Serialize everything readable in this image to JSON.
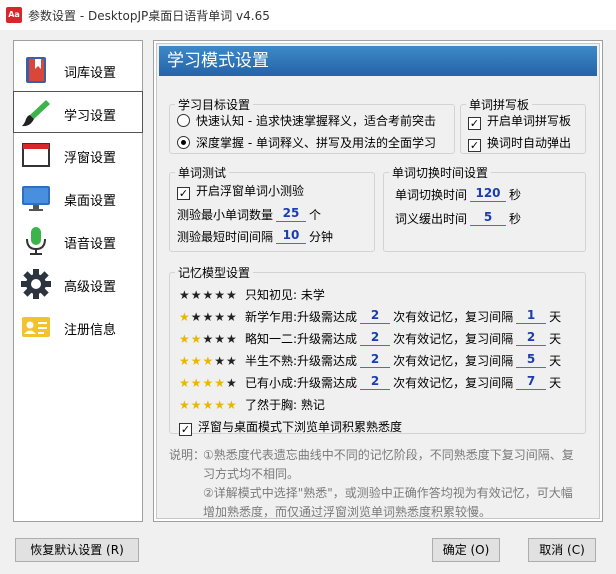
{
  "window": {
    "app_icon": "Aa",
    "title": "参数设置 - DesktopJP桌面日语背单词 v4.65"
  },
  "nav": [
    {
      "label": "词库设置",
      "icon": "book-icon"
    },
    {
      "label": "学习设置",
      "icon": "brush-icon"
    },
    {
      "label": "浮窗设置",
      "icon": "window-icon"
    },
    {
      "label": "桌面设置",
      "icon": "monitor-icon"
    },
    {
      "label": "语音设置",
      "icon": "microphone-icon"
    },
    {
      "label": "高级设置",
      "icon": "gear-icon"
    },
    {
      "label": "注册信息",
      "icon": "id-card-icon"
    }
  ],
  "active_nav": "学习设置",
  "page_title": "学习模式设置",
  "goal": {
    "legend": "学习目标设置",
    "option1": "快速认知 - 追求快速掌握释义，适合考前突击",
    "option2": "深度掌握 - 单词释义、拼写及用法的全面学习",
    "selected": "深度掌握"
  },
  "spelling": {
    "legend": "单词拼写板",
    "open_label": "开启单词拼写板",
    "auto_popup_label": "换词时自动弹出",
    "open_checked": true,
    "auto_popup_checked": true
  },
  "quiz": {
    "legend": "单词测试",
    "enable_label": "开启浮窗单词小测验",
    "enable_checked": true,
    "min_words_prefix": "测验最小单词数量",
    "min_words_value": "25",
    "min_words_unit": "个",
    "min_interval_prefix": "测验最短时间间隔",
    "min_interval_value": "10",
    "min_interval_unit": "分钟"
  },
  "switch": {
    "legend": "单词切换时间设置",
    "switch_prefix": "单词切换时间",
    "switch_value": "120",
    "switch_unit": "秒",
    "delay_prefix": "词义缓出时间",
    "delay_value": "5",
    "delay_unit": "秒"
  },
  "memory": {
    "legend": "记忆模型设置",
    "levels": [
      {
        "stars_filled": 0,
        "name": "只知初见:",
        "text": "未学"
      },
      {
        "stars_filled": 1,
        "name": "新学乍用:",
        "upgrade": "升级需达成",
        "count": "2",
        "mid": "次有效记忆，复习间隔",
        "days": "1",
        "unit": "天"
      },
      {
        "stars_filled": 2,
        "name": "略知一二:",
        "upgrade": "升级需达成",
        "count": "2",
        "mid": "次有效记忆，复习间隔",
        "days": "2",
        "unit": "天"
      },
      {
        "stars_filled": 3,
        "name": "半生不熟:",
        "upgrade": "升级需达成",
        "count": "2",
        "mid": "次有效记忆，复习间隔",
        "days": "5",
        "unit": "天"
      },
      {
        "stars_filled": 4,
        "name": "已有小成:",
        "upgrade": "升级需达成",
        "count": "2",
        "mid": "次有效记忆，复习间隔",
        "days": "7",
        "unit": "天"
      },
      {
        "stars_filled": 5,
        "name": "了然于胸:",
        "text": "熟记"
      }
    ],
    "browse_label": "浮窗与桌面模式下浏览单词积累熟悉度",
    "browse_checked": true
  },
  "note": {
    "label": "说明：",
    "line1": "①熟悉度代表遗忘曲线中不同的记忆阶段，不同熟悉度下复习间隔、复",
    "line2": "习方式均不相同。",
    "line3": "②详解模式中选择\"熟悉\"，或测验中正确作答均视为有效记忆，可大幅",
    "line4": "增加熟悉度，而仅通过浮窗浏览单词熟悉度积累较慢。"
  },
  "buttons": {
    "restore": "恢复默认设置 (R)",
    "ok": "确定 (O)",
    "cancel": "取消 (C)"
  },
  "colors": {
    "title_bar": "#2d6fb5",
    "link_value": "#1a3db0",
    "star_filled": "#e8b800"
  }
}
